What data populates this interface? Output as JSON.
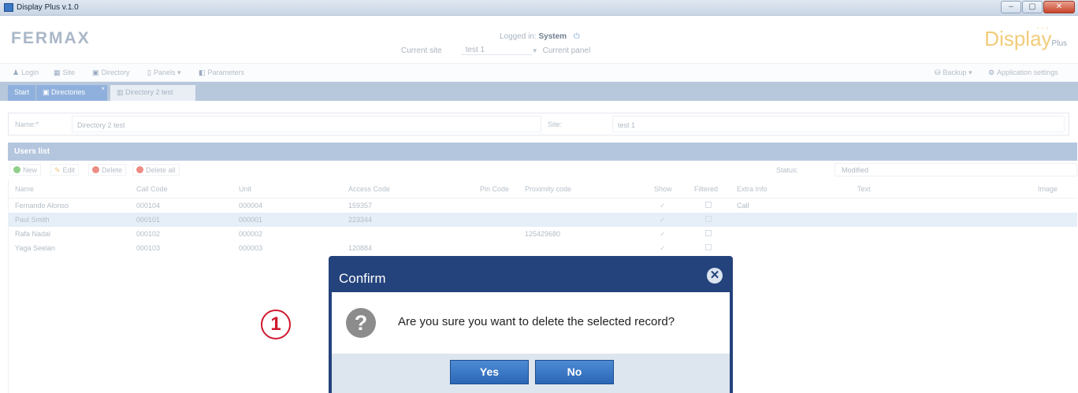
{
  "window": {
    "title": "Display Plus v.1.0",
    "controls": [
      "–",
      "▢",
      "✕"
    ]
  },
  "header": {
    "logo": "FERMAX",
    "brand": "Display",
    "brand_sub": "Plus",
    "logged_label": "Logged in:",
    "logged_user": "System",
    "current_site_label": "Current site",
    "current_site_value": "test 1",
    "current_panel_label": "Current panel"
  },
  "toolbar": {
    "login": "Login",
    "site": "Site",
    "directory": "Directory",
    "panels": "Panels",
    "parameters": "Parameters",
    "backup": "Backup",
    "app_settings": "Application settings"
  },
  "tabs": {
    "start": "Start",
    "directories": "Directories",
    "directory2": "Directory 2 test"
  },
  "form": {
    "name_label": "Name:*",
    "name_value": "Directory 2 test",
    "site_label": "Site:",
    "site_value": "test 1"
  },
  "users": {
    "title": "Users list",
    "new": "New",
    "edit": "Edit",
    "delete": "Delete",
    "delete_all": "Delete all",
    "status_label": "Status:",
    "status_value": "Modified",
    "columns": {
      "name": "Name",
      "call_code": "Call Code",
      "unit": "Unit",
      "access_code": "Access Code",
      "pin_code": "Pin Code",
      "proximity_code": "Proximity code",
      "show": "Show",
      "filtered": "Filtered",
      "extra_info": "Extra Info",
      "text": "Text",
      "image": "Image"
    },
    "rows": [
      {
        "name": "Fernando Alonso",
        "call_code": "000104",
        "unit": "000004",
        "access_code": "159357",
        "proximity": "",
        "extra": "Call"
      },
      {
        "name": "Paul Smith",
        "call_code": "000101",
        "unit": "000001",
        "access_code": "223344",
        "proximity": "",
        "extra": ""
      },
      {
        "name": "Rafa Nadal",
        "call_code": "000102",
        "unit": "000002",
        "access_code": "",
        "proximity": "125429680",
        "extra": ""
      },
      {
        "name": "Yaga Seelan",
        "call_code": "000103",
        "unit": "000003",
        "access_code": "120884",
        "proximity": "",
        "extra": ""
      }
    ]
  },
  "marker": "1",
  "dialog": {
    "title": "Confirm",
    "message": "Are you sure you want to delete the selected record?",
    "yes": "Yes",
    "no": "No"
  }
}
